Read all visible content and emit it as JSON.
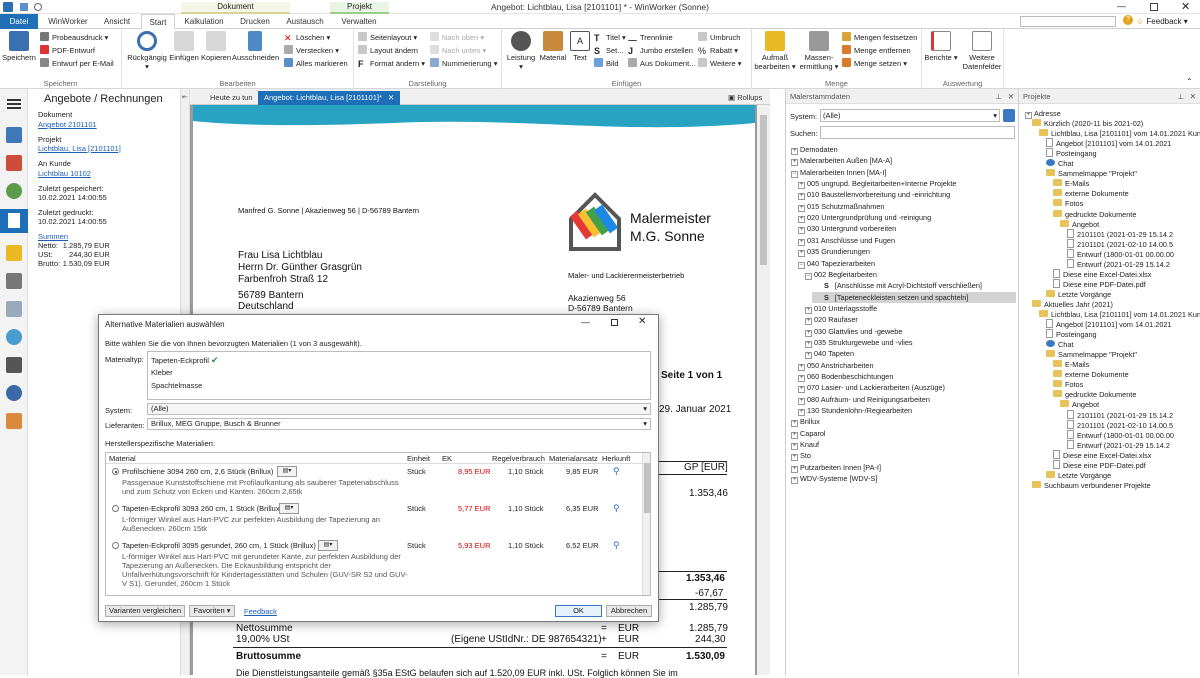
{
  "window": {
    "title": "Angebot: Lichtblau, Lisa [2101101] * - WinWorker (Sonne)",
    "context_document": "Dokument",
    "context_project": "Projekt",
    "search_placeholder": "",
    "help_label": "?",
    "feedback_label": "Feedback"
  },
  "tabs": [
    "Datei",
    "WinWorker",
    "Ansicht",
    "Start",
    "Kalkulation",
    "Drucken",
    "Austausch",
    "Verwalten"
  ],
  "ribbon": {
    "speichern": {
      "label": "Speichern",
      "group": "Speichern",
      "probe": "Probeausdruck",
      "pdf": "PDF-Entwurf",
      "email": "Entwurf per E-Mail"
    },
    "bearbeiten": {
      "group": "Bearbeiten",
      "rueck": "Rückgängig",
      "einf": "Einfügen",
      "kop": "Kopieren",
      "aus": "Ausschneiden",
      "loeschen": "Löschen",
      "verstecken": "Verstecken",
      "alle": "Alles markieren"
    },
    "darstellung": {
      "group": "Darstellung",
      "seitenlayout": "Seitenlayout",
      "layout": "Layout ändern",
      "format": "Format ändern",
      "nach_oben": "Nach oben",
      "nach_unten": "Nach unten",
      "num": "Nummerierung"
    },
    "einfuegen": {
      "group": "Einfügen",
      "leistung": "Leistung",
      "material": "Material",
      "text": "Text",
      "titel": "Titel",
      "set": "Set...",
      "bild": "Bild",
      "trenn": "Trennlinie",
      "jumbo": "Jumbo erstellen",
      "ausdok": "Aus Dokument...",
      "umbruch": "Umbruch",
      "rabatt": "Rabatt",
      "weitere": "Weitere"
    },
    "menge": {
      "group": "Menge",
      "aufmass": "Aufmaß bearbeiten",
      "massen": "Massen-ermittlung",
      "fest": "Mengen festsetzen",
      "entf": "Menge entfernen",
      "setzen": "Menge setzen"
    },
    "auswertung": {
      "group": "Auswertung",
      "berichte": "Berichte",
      "weitere": "Weitere Datenfelder"
    }
  },
  "info": {
    "header": "Angebote / Rechnungen",
    "doc_label": "Dokument",
    "doc_link": "Angebot 2101101",
    "proj_label": "Projekt",
    "proj_link": "Lichtblau, Lisa [2101101]",
    "kunde_label": "An Kunde",
    "kunde_link": "Lichtblau 10102",
    "saved_label": "Zuletzt gespeichert:",
    "saved": "10.02.2021 14:00:55",
    "printed_label": "Zuletzt gedruckt:",
    "printed": "10.02.2021 14:00:55",
    "sum_link": "Summen",
    "netto_l": "Netto:",
    "netto": "1.285,79",
    "ust_l": "USt:",
    "ust": "244,30",
    "brutto_l": "Brutto:",
    "brutto": "1.530,09",
    "cur": "EUR"
  },
  "doctabs": {
    "t1": "Heute zu tun",
    "t2": "Angebot: Lichtblau, Lisa [2101101]*",
    "rollups": "Rollups"
  },
  "letter": {
    "sender": "Manfred G. Sonne | Akazienweg 56 | D-56789 Bantern",
    "r1": "Frau Lisa Lichtblau",
    "r2": "Herrn Dr. Günther Grasgrün",
    "r3": "Farbenfroh Straß 12",
    "r4": "56789 Bantern",
    "r5": "Deutschland",
    "logo1": "Malermeister",
    "logo2": "M.G. Sonne",
    "sub": "Maler- und Lackierermeisterbetrieb",
    "a1": "Akazienweg 56",
    "a2": "D-56789 Bantern",
    "seite": "Seite 1 von 1",
    "datum": "29. Januar 2021",
    "gp": "GP [EUR]",
    "v1": "1.353,46",
    "v2": "1.353,46",
    "v3": "-67,67",
    "v4": "1.285,79",
    "netto_l": "Nettosumme",
    "ust_l": "19,00% USt",
    "ustid": "(Eigene UStIdNr.: DE 987654321)",
    "plus": "+",
    "eq": "=",
    "eur": "EUR",
    "netto": "1.285,79",
    "ust": "244,30",
    "brutto_l": "Bruttosumme",
    "brutto": "1.530,09",
    "foot": "Die Dienstleistungsanteile gemäß §35a EStG belaufen sich auf 1.520,09 EUR inkl. USt. Folglich können Sie im"
  },
  "mal": {
    "header": "Malerstammdaten",
    "system_l": "System:",
    "system": "(Alle)",
    "suchen_l": "Suchen:",
    "tree": [
      "Demodaten",
      "Malerarbeiten Außen [MA-A]",
      "Malerarbeiten Innen [MA-I]",
      "005 ungrupd. Begleitarbeiten+Interne Projekte",
      "010 Baustellenvorbereitung und -einrichtung",
      "015 Schutzmaßnahmen",
      "020 Untergrundprüfung und -reinigung",
      "030 Untergrund vorbereiten",
      "031 Anschlüsse und Fugen",
      "035 Grundierungen",
      "040 Tapezierarbeiten",
      "002 Begleitarbeiten",
      "[Anschlüsse mit Acryl-Dichtstoff verschließen]",
      "[Tapeteneckleisten setzen und spachteln]",
      "010 Unterlagsstoffe",
      "020 Raufaser",
      "030 Glattvlies und -gewebe",
      "035 Strukturgewebe und -vlies",
      "040 Tapeten",
      "050 Anstricharbeiten",
      "060 Bodenbeschichtungen",
      "070 Lasier- und Lackierarbeiten (Auszüge)",
      "080 Aufräum- und Reinigungsarbeiten",
      "130 Stundenlohn-/Regiearbeiten",
      "Brillux",
      "Caparol",
      "Knauf",
      "Sto",
      "Putzarbeiten Innen [PA-I]",
      "WDV-Systeme [WDV-S]"
    ]
  },
  "proj": {
    "header": "Projekte",
    "tree": [
      "Adresse",
      "Kürzlich (2020-11 bis 2021-02)",
      "Lichtblau, Lisa [2101101] vom 14.01.2021 Kun",
      "Angebot [2101101] vom 14.01.2021",
      "Posteingang",
      "Chat",
      "Sammelmappe \"Projekt\"",
      "E-Mails",
      "externe Dokumente",
      "Fotos",
      "gedruckte Dokumente",
      "Angebot",
      "2101101 (2021-01-29 15.14.2",
      "2101101 (2021-02-10 14.00.5",
      "Entwurf (1800-01-01 00.00.00",
      "Entwurf (2021-01-29 15.14.2",
      "Diese eine Excel-Datei.xlsx",
      "Diese eine PDF-Datei.pdf",
      "Letzte Vorgänge",
      "Aktuelles Jahr (2021)",
      "Lichtblau, Lisa [2101101] vom 14.01.2021 Kun",
      "Angebot [2101101] vom 14.01.2021",
      "Posteingang",
      "Chat",
      "Sammelmappe \"Projekt\"",
      "E-Mails",
      "externe Dokumente",
      "Fotos",
      "gedruckte Dokumente",
      "Angebot",
      "2101101 (2021-01-29 15.14.2",
      "2101101 (2021-02-10 14.00.5",
      "Entwurf (1800-01-01 00.00.00",
      "Entwurf (2021-01-29 15.14.2",
      "Diese eine Excel-Datei.xlsx",
      "Diese eine PDF-Datei.pdf",
      "Letzte Vorgänge",
      "Suchbaum verbundener Projekte"
    ]
  },
  "dialog": {
    "title": "Alternative Materialien auswählen",
    "instr": "Bitte wählen Sie die von Ihnen bevorzugten Materialien (1 von 3 ausgewählt).",
    "typ_l": "Materialtyp:",
    "types": [
      "Tapeten-Eckprofil",
      "Kleber",
      "Spachtelmasse"
    ],
    "system_l": "System:",
    "system": "(Alle)",
    "lief_l": "Lieferanten:",
    "lief": "Brillux, MEG Gruppe, Busch & Brunner",
    "herst_l": "Herstellerspezifische Materialien:",
    "cols": [
      "Material",
      "Einheit",
      "EK",
      "Regelverbrauch",
      "Materialansatz",
      "Herkunft"
    ],
    "rows": [
      {
        "name": "Profilschiene 3094 260 cm, 2,6  Stück  (Brillux)",
        "desc1": "Passgenaue Kunststoffschiene mit Profilaufkantung als sauberer Tapetenabschluss",
        "desc2": "und zum Schutz von Ecken und Kanten. 260cm 2,65tk",
        "desc3": "",
        "desc4": "",
        "unit": "Stück",
        "ek": "8,95 EUR",
        "regel": "1,10 Stück",
        "ansatz": "9,85 EUR"
      },
      {
        "name": "Tapeten-Eckprofil 3093 260 cm, 1 Stück  (Brillux)",
        "desc1": "L-förmiger Winkel aus Hart-PVC zur perfekten Ausbildung der Tapezierung an",
        "desc2": "Außenecken. 260cm 15tk",
        "desc3": "",
        "desc4": "",
        "unit": "Stück",
        "ek": "5,77 EUR",
        "regel": "1,10 Stück",
        "ansatz": "6,35 EUR"
      },
      {
        "name": "Tapeten-Eckprofil 3095 gerundet, 260 cm, 1 Stück  (Brillux)",
        "desc1": "L-förmiger Winkel aus Hart-PVC mit gerundeter Kante, zur perfekten Ausbildung der",
        "desc2": "Tapezierung an Außenecken. Die Eckausbildung entspricht der",
        "desc3": "Unfallverhütungsvorschrift für Kindertagesstätten und Schulen (GUV-SR S2 und GUV-",
        "desc4": "V S1). Gerundet, 260cm 1 Stück",
        "unit": "Stück",
        "ek": "5,93 EUR",
        "regel": "1,10 Stück",
        "ansatz": "6,52 EUR"
      }
    ],
    "vergleich": "Varianten vergleichen",
    "favoriten": "Favoriten",
    "feedback": "Feedback",
    "ok": "OK",
    "abbrechen": "Abbrechen"
  },
  "colors": {
    "accent": "#1e6fb8",
    "teal": "#29a3c2",
    "ek_red": "#dd0000"
  }
}
